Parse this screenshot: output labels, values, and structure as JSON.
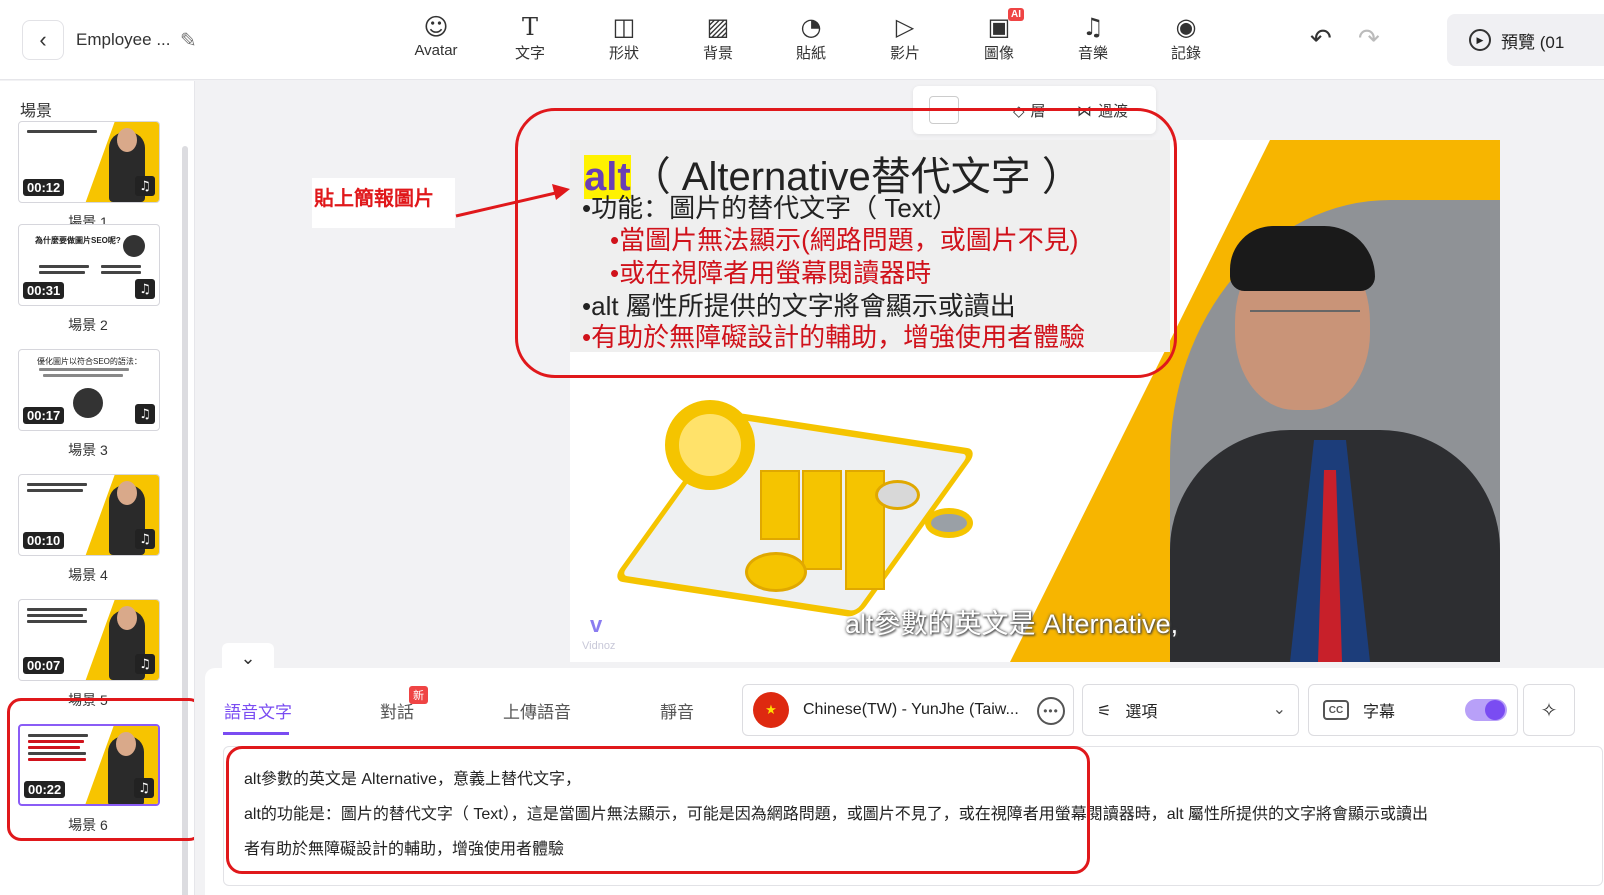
{
  "header": {
    "back_icon": "chevron-left-icon",
    "project_title": "Employee ...",
    "tools": [
      {
        "label": "Avatar",
        "icon": "avatar-icon"
      },
      {
        "label": "文字",
        "icon": "text-icon"
      },
      {
        "label": "形狀",
        "icon": "shapes-icon"
      },
      {
        "label": "背景",
        "icon": "background-icon"
      },
      {
        "label": "貼紙",
        "icon": "sticker-icon"
      },
      {
        "label": "影片",
        "icon": "video-icon"
      },
      {
        "label": "圖像",
        "icon": "image-icon",
        "badge": "AI"
      },
      {
        "label": "音樂",
        "icon": "music-icon"
      },
      {
        "label": "記錄",
        "icon": "record-icon"
      }
    ],
    "preview_label": "預覽 (01"
  },
  "sidebar": {
    "title": "場景",
    "scenes": [
      {
        "name": "場景 1",
        "duration": "00:12"
      },
      {
        "name": "場景 2",
        "duration": "00:31",
        "thumb_title": "為什麼要做圖片SEO呢?"
      },
      {
        "name": "場景 3",
        "duration": "00:17",
        "thumb_title": "優化圖片以符合SEO的語法："
      },
      {
        "name": "場景 4",
        "duration": "00:10"
      },
      {
        "name": "場景 5",
        "duration": "00:07"
      },
      {
        "name": "場景 6",
        "duration": "00:22",
        "active": true
      }
    ]
  },
  "canvas": {
    "float_toolbar": {
      "layer_label": "層",
      "transition_label": "過渡"
    },
    "annotation": "貼上簡報圖片",
    "slide": {
      "title_alt": "alt",
      "title_rest": "（ Alternative替代文字 ）",
      "lines": [
        {
          "text": "•功能：圖片的替代文字（ Text）",
          "color": "#222222"
        },
        {
          "text": "•當圖片無法顯示(網路問題，或圖片不見)",
          "color": "#d0121b"
        },
        {
          "text": "•或在視障者用螢幕閱讀器時",
          "color": "#d0121b"
        },
        {
          "text": "•alt 屬性所提供的文字將會顯示或讀出",
          "color": "#222222"
        },
        {
          "text": "•有助於無障礙設計的輔助，增強使用者體驗",
          "color": "#d0121b"
        }
      ],
      "watermark": "Vidnoz",
      "subtitle": "alt參數的英文是 Alternative,"
    }
  },
  "bottom": {
    "tabs": [
      {
        "label": "語音文字",
        "active": true
      },
      {
        "label": "對話",
        "badge": "新"
      },
      {
        "label": "上傳語音"
      },
      {
        "label": "靜音"
      }
    ],
    "voice": "Chinese(TW) - YunJhe (Taiw...",
    "options_label": "選項",
    "subtitle_label": "字幕",
    "subtitle_enabled": true,
    "script_lines": [
      "alt參數的英文是 Alternative，意義上替代文字，",
      "alt的功能是：圖片的替代文字（ Text），這是當圖片無法顯示，可能是因為網路問題，或圖片不見了，或在視障者用螢幕閱讀器時，alt 屬性所提供的文字將會顯示或讀出",
      "者有助於無障礙設計的輔助，增強使用者體驗"
    ]
  },
  "colors": {
    "accent": "#7a4cf2",
    "annotation_red": "#e0181b",
    "slide_yellow": "#f7b500"
  }
}
